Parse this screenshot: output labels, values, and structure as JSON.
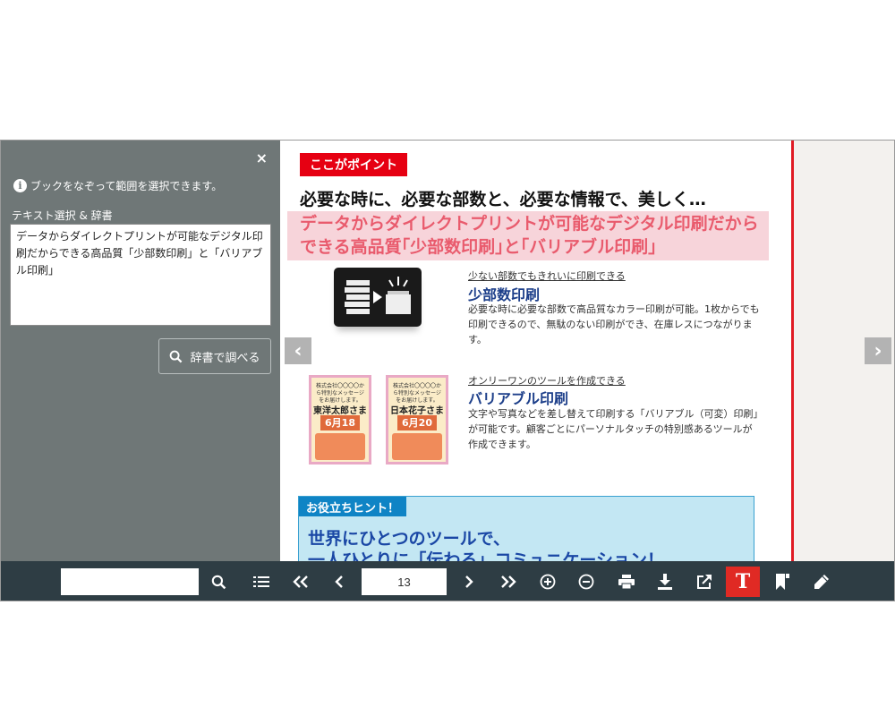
{
  "side_panel": {
    "close_label": "×",
    "info_text": "ブックをなぞって範囲を選択できます。",
    "section_label": "テキスト選択 & 辞書",
    "selected_text": "データからダイレクトプリントが可能なデジタル印刷だからできる高品質「少部数印刷」と「バリアブル印刷」",
    "dictionary_button": "辞書で調べる"
  },
  "page": {
    "point_badge": "ここがポイント",
    "headline": "必要な時に、必要な部数と、必要な情報で、美しく…",
    "highlight_line1": "データからダイレクトプリントが可能なデジタル印刷だから",
    "highlight_line2": "できる高品質｢少部数印刷｣と｢バリアブル印刷｣",
    "features": [
      {
        "caption": "少ない部数でもきれいに印刷できる",
        "title": "少部数印刷",
        "desc": "必要な時に必要な部数で高品質なカラー印刷が可能。1枚からでも印刷できるので、無駄のない印刷ができ、在庫レスにつながります。"
      },
      {
        "caption": "オンリーワンのツールを作成できる",
        "title": "バリアブル印刷",
        "desc": "文字や写真などを差し替えて印刷する「バリアブル（可変）印刷」が可能です。顧客ごとにパーソナルタッチの特別感あるツールが作成できます。"
      }
    ],
    "cards": [
      {
        "head": "株式会社〇〇〇〇から特別なメッセージをお届けします。",
        "name": "東洋太郎さま",
        "date": "6月18日"
      },
      {
        "head": "株式会社〇〇〇〇から特別なメッセージをお届けします。",
        "name": "日本花子さま",
        "date": "6月20日"
      }
    ],
    "hint_badge": "お役立ちヒント！",
    "hint_line1": "世界にひとつのツールで、",
    "hint_line2": "一人ひとりに「伝わる」コミュニケーション！"
  },
  "nav": {
    "prev": "‹",
    "next": "›"
  },
  "toolbar": {
    "search_value": "",
    "page_number": "13",
    "active_color": "#e02a24"
  },
  "icons": [
    "close-icon",
    "info-icon",
    "search-icon",
    "list-icon",
    "first-page-icon",
    "prev-page-icon",
    "next-page-icon",
    "last-page-icon",
    "zoom-in-icon",
    "zoom-out-icon",
    "print-icon",
    "download-icon",
    "share-icon",
    "text-select-icon",
    "bookmark-icon",
    "pen-icon"
  ]
}
